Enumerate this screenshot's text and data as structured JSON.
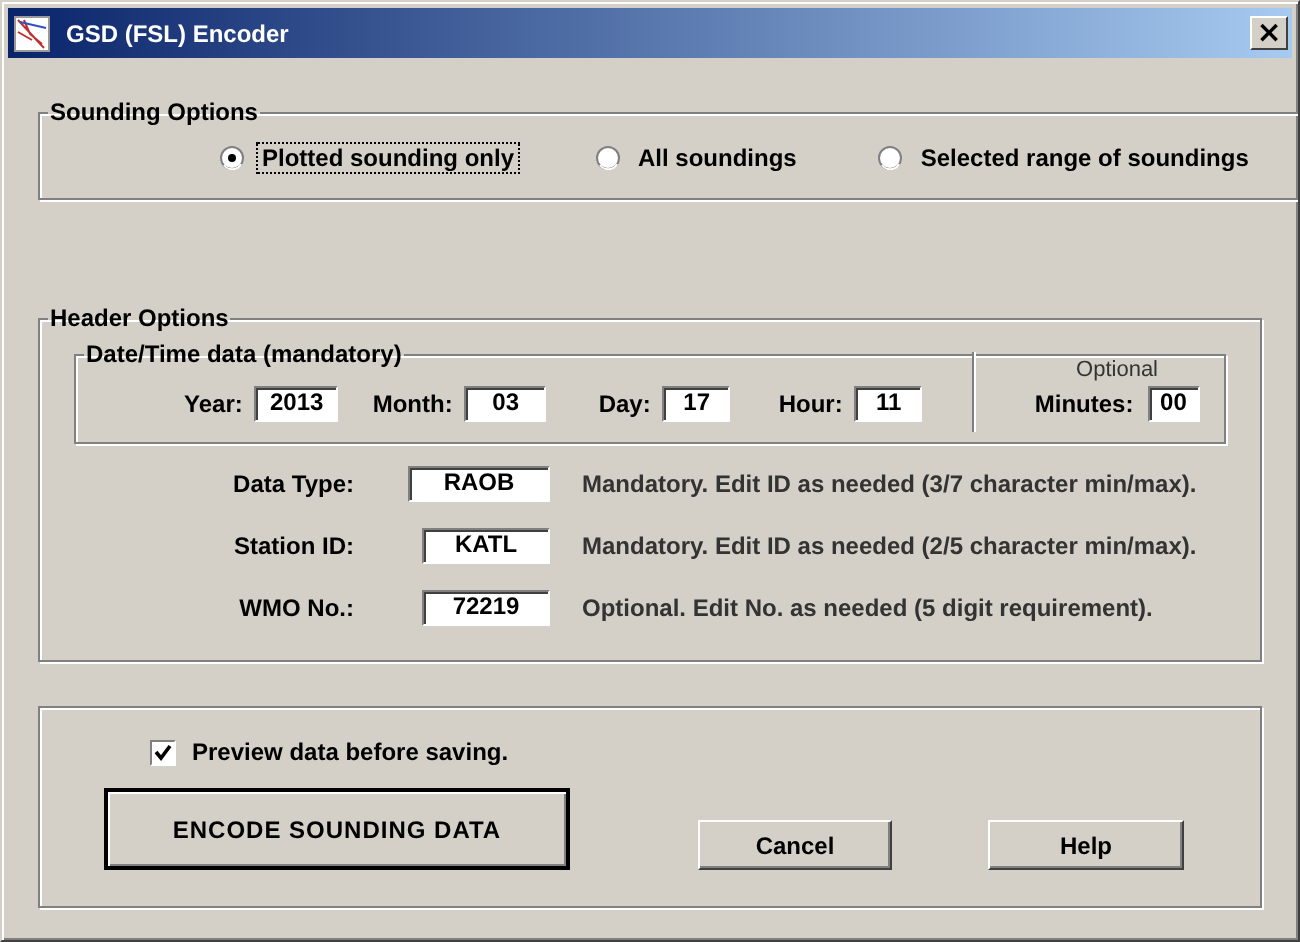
{
  "window": {
    "title": "GSD (FSL) Encoder",
    "close": "×"
  },
  "sounding_options": {
    "title": "Sounding Options",
    "options": [
      {
        "label": "Plotted sounding only",
        "selected": true,
        "focused": true
      },
      {
        "label": "All soundings",
        "selected": false,
        "focused": false
      },
      {
        "label": "Selected range of soundings",
        "selected": false,
        "focused": false
      }
    ]
  },
  "header_options": {
    "title": "Header Options",
    "date_time": {
      "title": "Date/Time data (mandatory)",
      "fields": [
        {
          "label": "Year:",
          "value": "2013"
        },
        {
          "label": "Month:",
          "value": "03"
        },
        {
          "label": "Day:",
          "value": "17"
        },
        {
          "label": "Hour:",
          "value": "11"
        }
      ],
      "optional": {
        "caption": "Optional",
        "label": "Minutes:",
        "value": "00"
      }
    },
    "rows": [
      {
        "label": "Data Type:",
        "value": "RAOB",
        "note": "Mandatory.  Edit ID as needed  (3/7 character min/max)."
      },
      {
        "label": "Station ID:",
        "value": "KATL",
        "note": "Mandatory.  Edit ID as needed  (2/5 character min/max)."
      },
      {
        "label": "WMO No.:",
        "value": "72219",
        "note": "Optional.  Edit No. as needed  (5 digit requirement)."
      }
    ]
  },
  "preview": {
    "label": "Preview data before saving.",
    "checked": true
  },
  "buttons": [
    {
      "label": "ENCODE SOUNDING DATA",
      "kind": "default"
    },
    {
      "label": "Cancel",
      "kind": "normal"
    },
    {
      "label": "Help",
      "kind": "normal"
    }
  ]
}
